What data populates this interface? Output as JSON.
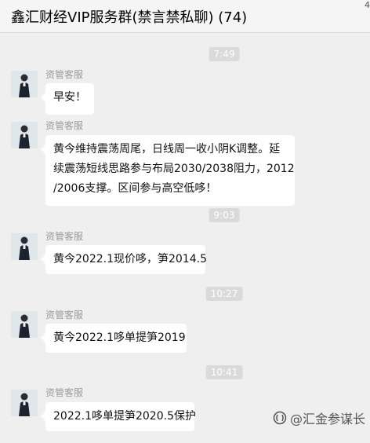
{
  "header": {
    "title": "鑫汇财经VIP服务群(禁言禁私聊) (74)",
    "edge_mark": "4"
  },
  "chat": {
    "sender_name": "资管客服",
    "times": [
      "7:49",
      "9:03",
      "10:27",
      "10:41"
    ],
    "messages": [
      {
        "text": "早安！"
      },
      {
        "line1": "黄今维持震荡周尾，日线周一收小阴K调整。延",
        "line2": "续震荡短线思路参与布局2030/2038阻力，2012",
        "line3": "/2006支撑。区间参与高空低哆！"
      },
      {
        "text": "黄今2022.1现价哆，笋2014.5"
      },
      {
        "text": "黄今2022.1哆单提笋2019"
      },
      {
        "text": "2022.1哆单提笋2020.5保护"
      }
    ]
  },
  "watermark": {
    "text": "@汇金参谋长"
  },
  "icons": {
    "avatar": "person-avatar-icon",
    "watermark_logo": "platform-logo-icon"
  },
  "colors": {
    "background": "#efefef",
    "bubble": "#ffffff",
    "time_pill": "#dadada",
    "sender": "#9b9b9b"
  }
}
